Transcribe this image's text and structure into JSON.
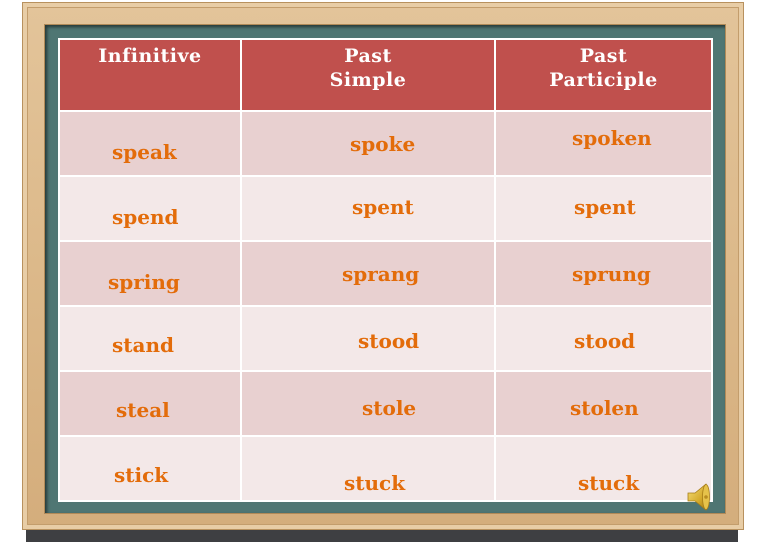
{
  "table": {
    "headers": [
      "Infinitive",
      "Past\nSimple",
      "Past\nParticiple"
    ],
    "header_lines": [
      [
        "Infinitive"
      ],
      [
        "Past",
        "Simple"
      ],
      [
        "Past",
        "Participle"
      ]
    ],
    "rows": [
      [
        "speak",
        "spoke",
        "spoken"
      ],
      [
        "spend",
        "spent",
        "spent"
      ],
      [
        "spring",
        "sprang",
        "sprung"
      ],
      [
        "stand",
        "stood",
        "stood"
      ],
      [
        "steal",
        "stole",
        "stolen"
      ],
      [
        "stick",
        "stuck",
        "stuck"
      ]
    ]
  },
  "audio": {
    "icon": "speaker-icon"
  },
  "colors": {
    "header_bg": "#c0504d",
    "row_odd": "#e8d0d0",
    "row_even": "#f3e8e8",
    "word_color": "#e36c0a",
    "board": "#4f7673",
    "frame": "#dcb98a"
  }
}
